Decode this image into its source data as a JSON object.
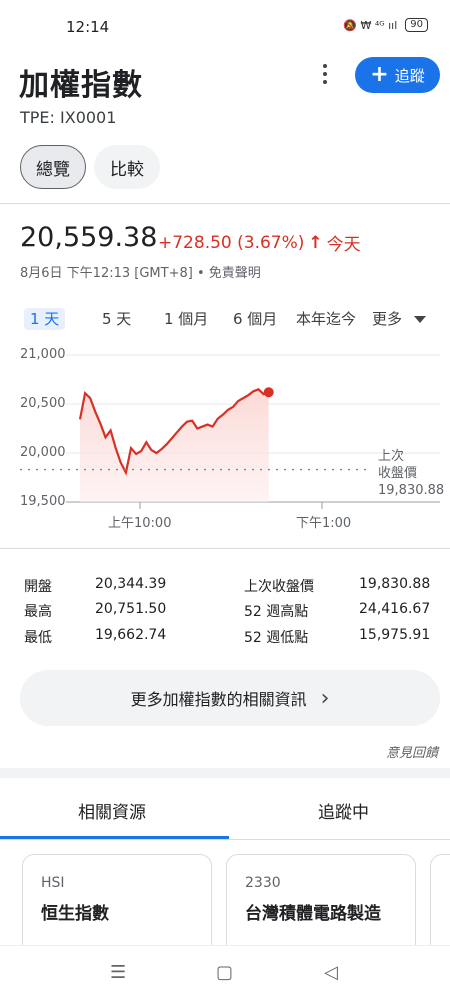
{
  "status_bar": {
    "time": "12:14",
    "icons": "🔕 ₩ ⁴ᴳ ııl",
    "battery": "90"
  },
  "header": {
    "title": "加權指數",
    "ticker": "TPE: IX0001",
    "follow_label": "追蹤",
    "tabs": [
      {
        "label": "總覽"
      },
      {
        "label": "比較"
      }
    ]
  },
  "quote": {
    "price": "20,559.38",
    "change": "+728.50 (3.67%)",
    "change_arrow": "↑",
    "period": "今天",
    "timestamp": "8月6日 下午12:13 [GMT+8] • 免責聲明"
  },
  "ranges": {
    "items": [
      "1 天",
      "5 天",
      "1 個月",
      "6 個月",
      "本年迄今",
      "更多"
    ],
    "selected": "1 天"
  },
  "chart_data": {
    "type": "area",
    "y_ticks": [
      "21,000",
      "20,500",
      "20,000",
      "19,500"
    ],
    "ylim": [
      19500,
      21000
    ],
    "x_ticks": [
      "上午10:00",
      "下午1:00"
    ],
    "previous_close_label": [
      "上次",
      "收盤價",
      "19,830.88"
    ],
    "previous_close": 19830.88,
    "line_color": "#d93025",
    "series": [
      {
        "values": [
          20344,
          20610,
          20560,
          20420,
          20300,
          20160,
          20230,
          20050,
          19900,
          19800,
          20050,
          19990,
          20020,
          20110,
          20030,
          20000,
          20040,
          20090,
          20150,
          20210,
          20270,
          20320,
          20330,
          20250,
          20270,
          20290,
          20270,
          20350,
          20390,
          20440,
          20470,
          20530,
          20560,
          20590,
          20630,
          20650,
          20600,
          20620
        ]
      }
    ]
  },
  "stats": {
    "left": [
      {
        "label": "開盤",
        "value": "20,344.39"
      },
      {
        "label": "最高",
        "value": "20,751.50"
      },
      {
        "label": "最低",
        "value": "19,662.74"
      }
    ],
    "right": [
      {
        "label": "上次收盤價",
        "value": "19,830.88"
      },
      {
        "label": "52 週高點",
        "value": "24,416.67"
      },
      {
        "label": "52 週低點",
        "value": "15,975.91"
      }
    ]
  },
  "more_info": {
    "label": "更多加權指數的相關資訊",
    "chevron": "›"
  },
  "feedback": "意見回饋",
  "lower_tabs": [
    {
      "label": "相關資源"
    },
    {
      "label": "追蹤中"
    }
  ],
  "cards": [
    {
      "symbol": "HSI",
      "name": "恒生指數"
    },
    {
      "symbol": "2330",
      "name": "台灣積體電路製造"
    }
  ],
  "navbar": {
    "menu": "☰",
    "home": "▢",
    "back": "◁"
  }
}
